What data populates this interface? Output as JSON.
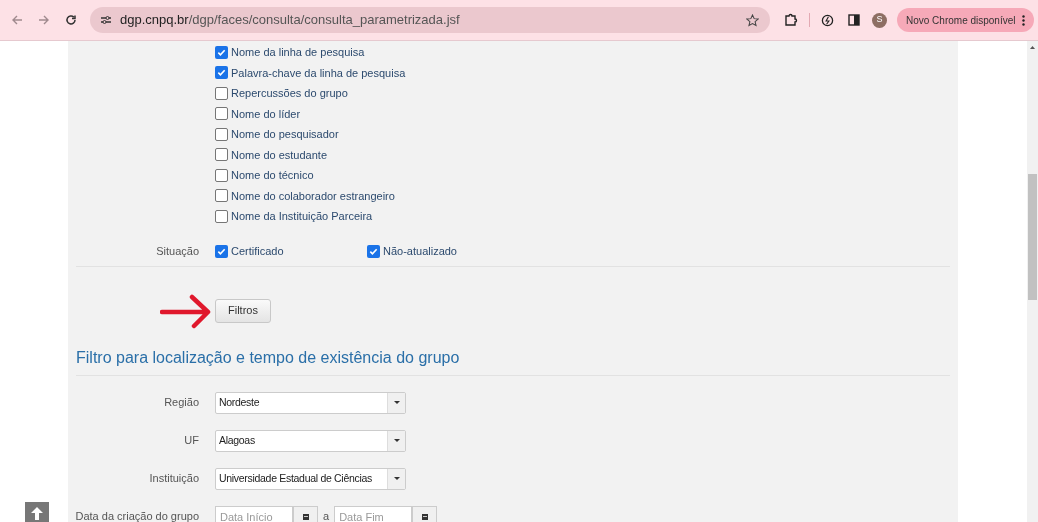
{
  "browser": {
    "url_host": "dgp.cnpq.br",
    "url_path": "/dgp/faces/consulta/consulta_parametrizada.jsf",
    "avatar": "S",
    "update_button": "Novo Chrome disponível"
  },
  "search_fields": [
    {
      "label": "Nome da linha de pesquisa",
      "checked": true
    },
    {
      "label": "Palavra-chave da linha de pesquisa",
      "checked": true
    },
    {
      "label": "Repercussões do grupo",
      "checked": false
    },
    {
      "label": "Nome do líder",
      "checked": false
    },
    {
      "label": "Nome do pesquisador",
      "checked": false
    },
    {
      "label": "Nome do estudante",
      "checked": false
    },
    {
      "label": "Nome do técnico",
      "checked": false
    },
    {
      "label": "Nome do colaborador estrangeiro",
      "checked": false
    },
    {
      "label": "Nome da Instituição Parceira",
      "checked": false
    }
  ],
  "situacao": {
    "label": "Situação",
    "options": [
      {
        "label": "Certificado",
        "checked": true
      },
      {
        "label": "Não-atualizado",
        "checked": true
      }
    ]
  },
  "filter_button": "Filtros",
  "section": {
    "title": "Filtro para localização e tempo de existência do grupo",
    "selects": [
      {
        "label": "Região",
        "value": "Nordeste"
      },
      {
        "label": "UF",
        "value": "Alagoas"
      },
      {
        "label": "Instituição",
        "value": "Universidade Estadual de Ciências"
      }
    ],
    "date_range": {
      "label": "Data da criação do grupo",
      "start_placeholder": "Data Início",
      "separator": "a",
      "end_placeholder": "Data Fim"
    }
  }
}
